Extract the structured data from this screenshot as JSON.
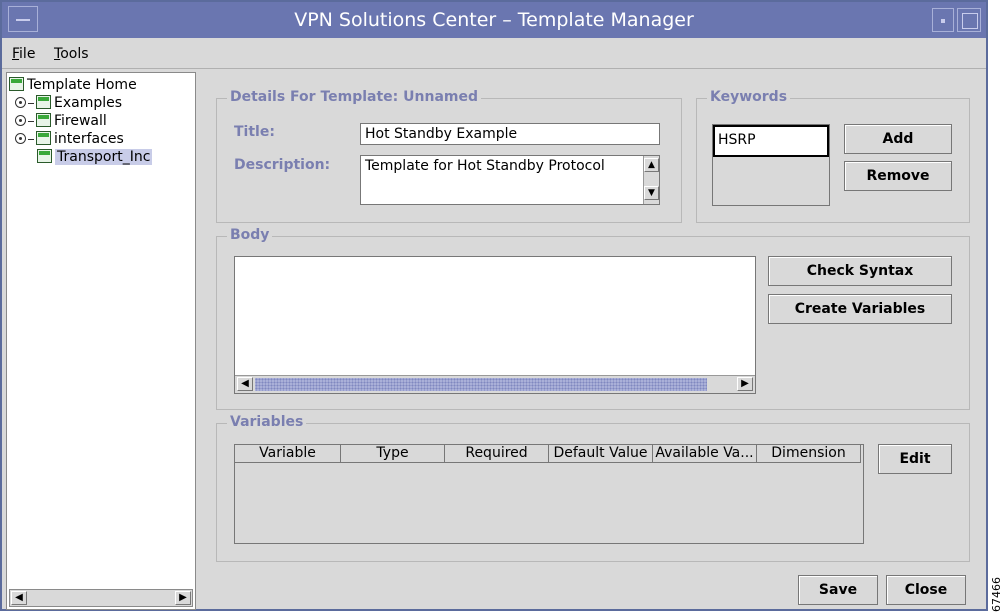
{
  "window": {
    "title": "VPN Solutions Center – Template Manager"
  },
  "menubar": {
    "items": [
      {
        "label": "File",
        "mnemonic": "F"
      },
      {
        "label": "Tools",
        "mnemonic": "T"
      }
    ]
  },
  "tree": {
    "root": "Template Home",
    "items": [
      {
        "label": "Examples",
        "expandable": true
      },
      {
        "label": "Firewall",
        "expandable": true
      },
      {
        "label": "interfaces",
        "expandable": true
      },
      {
        "label": "Transport_Inc",
        "expandable": false,
        "selected": true
      }
    ]
  },
  "details": {
    "group_label": "Details For Template: Unnamed",
    "title_label": "Title:",
    "title_value": "Hot Standby Example",
    "description_label": "Description:",
    "description_value": "Template for Hot Standby Protocol"
  },
  "keywords": {
    "group_label": "Keywords",
    "items": [
      "HSRP"
    ],
    "add_label": "Add",
    "remove_label": "Remove"
  },
  "body": {
    "group_label": "Body",
    "text": "",
    "check_syntax_label": "Check Syntax",
    "create_variables_label": "Create Variables"
  },
  "variables": {
    "group_label": "Variables",
    "columns": [
      "Variable",
      "Type",
      "Required",
      "Default Value",
      "Available Va...",
      "Dimension"
    ],
    "rows": [],
    "edit_label": "Edit"
  },
  "footer": {
    "save_label": "Save",
    "close_label": "Close"
  },
  "side_code": "67466",
  "colors": {
    "titlebar": "#6a76b0",
    "group_label": "#7a7fb0",
    "background": "#d9d9d9"
  }
}
